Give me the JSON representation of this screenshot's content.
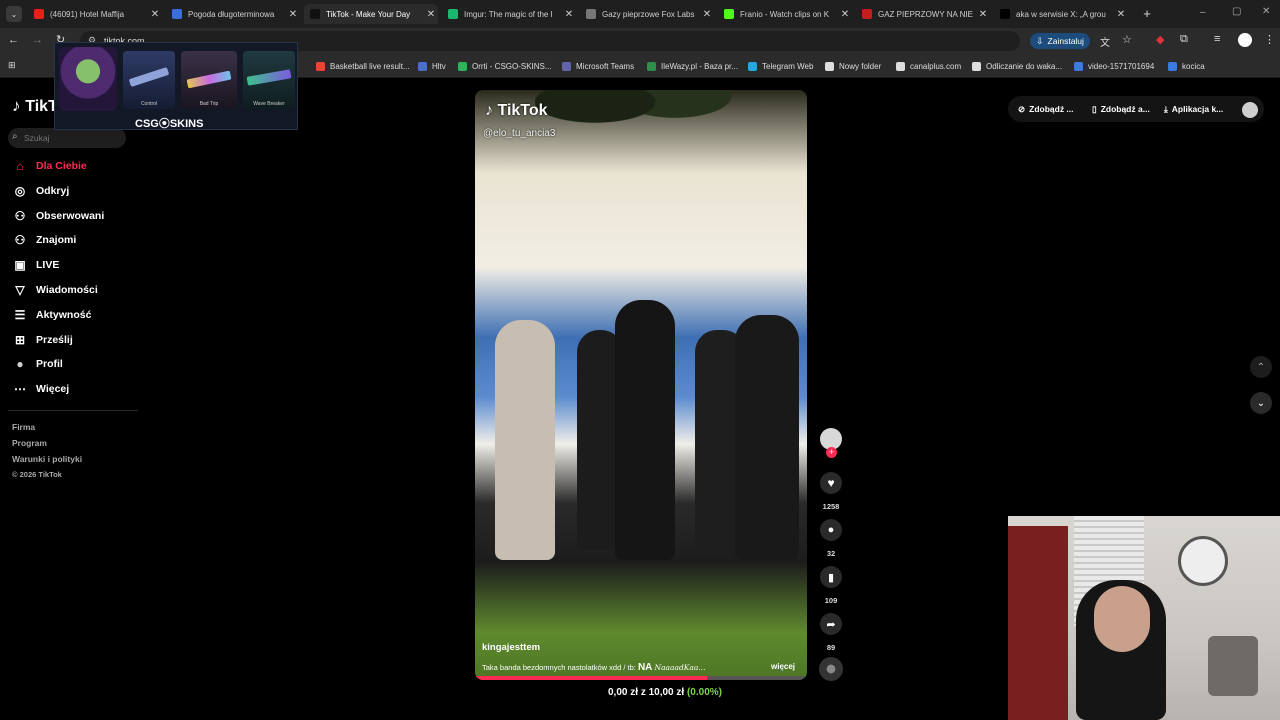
{
  "browser": {
    "tabs": [
      {
        "title": "(46091) Hotel Maffija",
        "color": "#e62117",
        "active": false
      },
      {
        "title": "Pogoda długoterminowa",
        "color": "#3a6fd8",
        "active": false
      },
      {
        "title": "TikTok - Make Your Day",
        "color": "#111111",
        "active": true
      },
      {
        "title": "Imgur: The magic of the I",
        "color": "#1bb76e",
        "active": false
      },
      {
        "title": "Gazy pieprzowe Fox Labs",
        "color": "#777777",
        "active": false
      },
      {
        "title": "Franio - Watch clips on K",
        "color": "#53fc18",
        "active": false
      },
      {
        "title": "GAZ PIEPRZOWY NA NIE",
        "color": "#c41e1e",
        "active": false
      },
      {
        "title": "aka w serwisie X: „A grou",
        "color": "#000000",
        "active": false
      }
    ],
    "url": "tiktok.com",
    "install_label": "Zainstaluj",
    "bookmarks": [
      {
        "label": "Basketball live result...",
        "color": "#e43"
      },
      {
        "label": "Hltv",
        "color": "#4a6fd0"
      },
      {
        "label": "Orrti - CSGO-SKINS...",
        "color": "#2eb35a"
      },
      {
        "label": "Microsoft Teams",
        "color": "#6264a7"
      },
      {
        "label": "IleWazy.pl - Baza pr...",
        "color": "#2f8f4a"
      },
      {
        "label": "Telegram Web",
        "color": "#2aa3e0"
      },
      {
        "label": "Nowy folder",
        "color": "#dddddd"
      },
      {
        "label": "canalplus.com",
        "color": "#dddddd"
      },
      {
        "label": "Odliczanie do waka...",
        "color": "#dddddd"
      },
      {
        "label": "video-1571701694",
        "color": "#3a7be0"
      },
      {
        "label": "kocica",
        "color": "#3a7be0"
      }
    ]
  },
  "overlay": {
    "brand": "CSG⦿SKINS",
    "skins": [
      "Control",
      "Bad Trip",
      "Wave Breaker"
    ]
  },
  "sidebar": {
    "search_placeholder": "Szukaj",
    "items": [
      {
        "label": "Dla Ciebie",
        "icon": "home-icon",
        "active": true
      },
      {
        "label": "Odkryj",
        "icon": "compass-icon",
        "active": false
      },
      {
        "label": "Obserwowani",
        "icon": "following-icon",
        "active": false
      },
      {
        "label": "Znajomi",
        "icon": "friends-icon",
        "active": false
      },
      {
        "label": "LIVE",
        "icon": "live-icon",
        "active": false
      },
      {
        "label": "Wiadomości",
        "icon": "messages-icon",
        "active": false
      },
      {
        "label": "Aktywność",
        "icon": "activity-icon",
        "active": false
      },
      {
        "label": "Prześlij",
        "icon": "upload-icon",
        "active": false
      },
      {
        "label": "Profil",
        "icon": "profile-icon",
        "active": false
      },
      {
        "label": "Więcej",
        "icon": "more-icon",
        "active": false
      }
    ],
    "footer": [
      "Firma",
      "Program",
      "Warunki i polityki",
      "© 2026 TikTok"
    ]
  },
  "header": {
    "pills": [
      "Zdobądź ...",
      "Zdobądź a...",
      "Aplikacja k..."
    ]
  },
  "video": {
    "watermark": "TikTok",
    "handle": "@elo_tu_ancia3",
    "author": "kingajesttem",
    "caption": "Taka banda bezdomnych nastolatków xdd / tb:",
    "caption_tag": "NA",
    "caption_tail": "NaaaadKaa...",
    "more": "więcej",
    "likes": "1258",
    "comments": "32",
    "saves": "109",
    "shares": "89"
  },
  "donation": {
    "current": "0,00 zł",
    "separator": "z",
    "goal": "10,00 zł",
    "percent": "(0.00%)"
  }
}
